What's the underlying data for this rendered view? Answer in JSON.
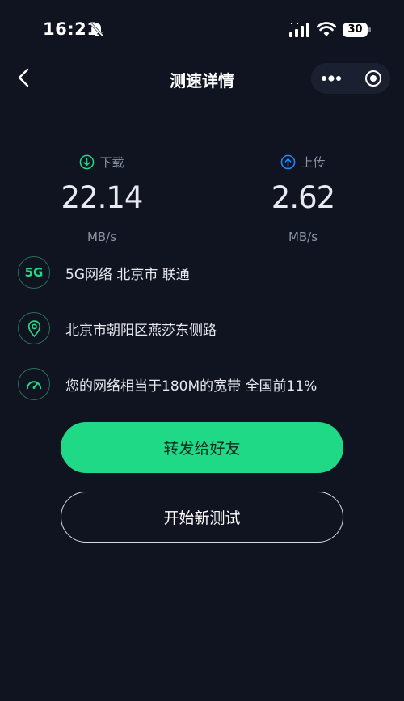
{
  "status_bar": {
    "time": "16:21",
    "battery": "30"
  },
  "nav": {
    "title": "测速详情"
  },
  "speeds": {
    "download": {
      "label": "下载",
      "value": "22.14",
      "unit": "MB/s"
    },
    "upload": {
      "label": "上传",
      "value": "2.62",
      "unit": "MB/s"
    }
  },
  "info": {
    "network": {
      "icon_text": "5G",
      "text": "5G网络 北京市 联通"
    },
    "location": {
      "text": "北京市朝阳区燕莎东侧路"
    },
    "bandwidth": {
      "text": "您的网络相当于180M的宽带 全国前11%"
    }
  },
  "buttons": {
    "share": "转发给好友",
    "retest": "开始新测试"
  },
  "colors": {
    "accent": "#1fd987",
    "upload_blue": "#1e8bff",
    "background": "#101421"
  }
}
